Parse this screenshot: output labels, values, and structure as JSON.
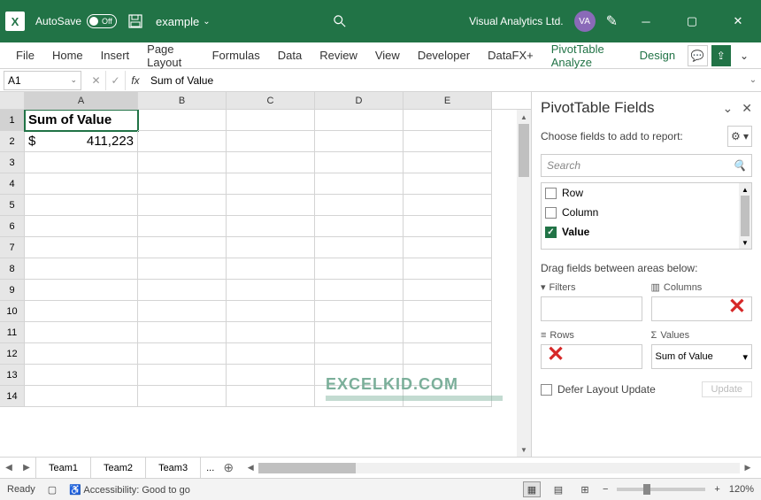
{
  "titlebar": {
    "autosave_label": "AutoSave",
    "autosave_state": "Off",
    "filename": "example",
    "user_name": "Visual Analytics Ltd.",
    "user_initials": "VA"
  },
  "ribbon": {
    "tabs": [
      "File",
      "Home",
      "Insert",
      "Page Layout",
      "Formulas",
      "Data",
      "Review",
      "View",
      "Developer",
      "DataFX+",
      "PivotTable Analyze",
      "Design"
    ]
  },
  "formula": {
    "name_box": "A1",
    "fx_label": "fx",
    "content": "Sum of Value"
  },
  "grid": {
    "columns": [
      "A",
      "B",
      "C",
      "D",
      "E"
    ],
    "rows": [
      "1",
      "2",
      "3",
      "4",
      "5",
      "6",
      "7",
      "8",
      "9",
      "10",
      "11",
      "12",
      "13",
      "14"
    ],
    "a1": "Sum of Value",
    "a2_currency": "$",
    "a2_value": "411,223"
  },
  "watermark": "EXCELKID.COM",
  "fieldpane": {
    "title": "PivotTable Fields",
    "desc": "Choose fields to add to report:",
    "search_placeholder": "Search",
    "fields": [
      {
        "label": "Row",
        "checked": false
      },
      {
        "label": "Column",
        "checked": false
      },
      {
        "label": "Value",
        "checked": true
      }
    ],
    "drag_label": "Drag fields between areas below:",
    "area_filters": "Filters",
    "area_columns": "Columns",
    "area_rows": "Rows",
    "area_values": "Values",
    "values_item": "Sum of Value",
    "defer_label": "Defer Layout Update",
    "update_label": "Update"
  },
  "sheets": {
    "tabs": [
      "Team1",
      "Team2",
      "Team3"
    ],
    "more": "..."
  },
  "statusbar": {
    "ready": "Ready",
    "accessibility": "Accessibility: Good to go",
    "zoom": "120%"
  }
}
